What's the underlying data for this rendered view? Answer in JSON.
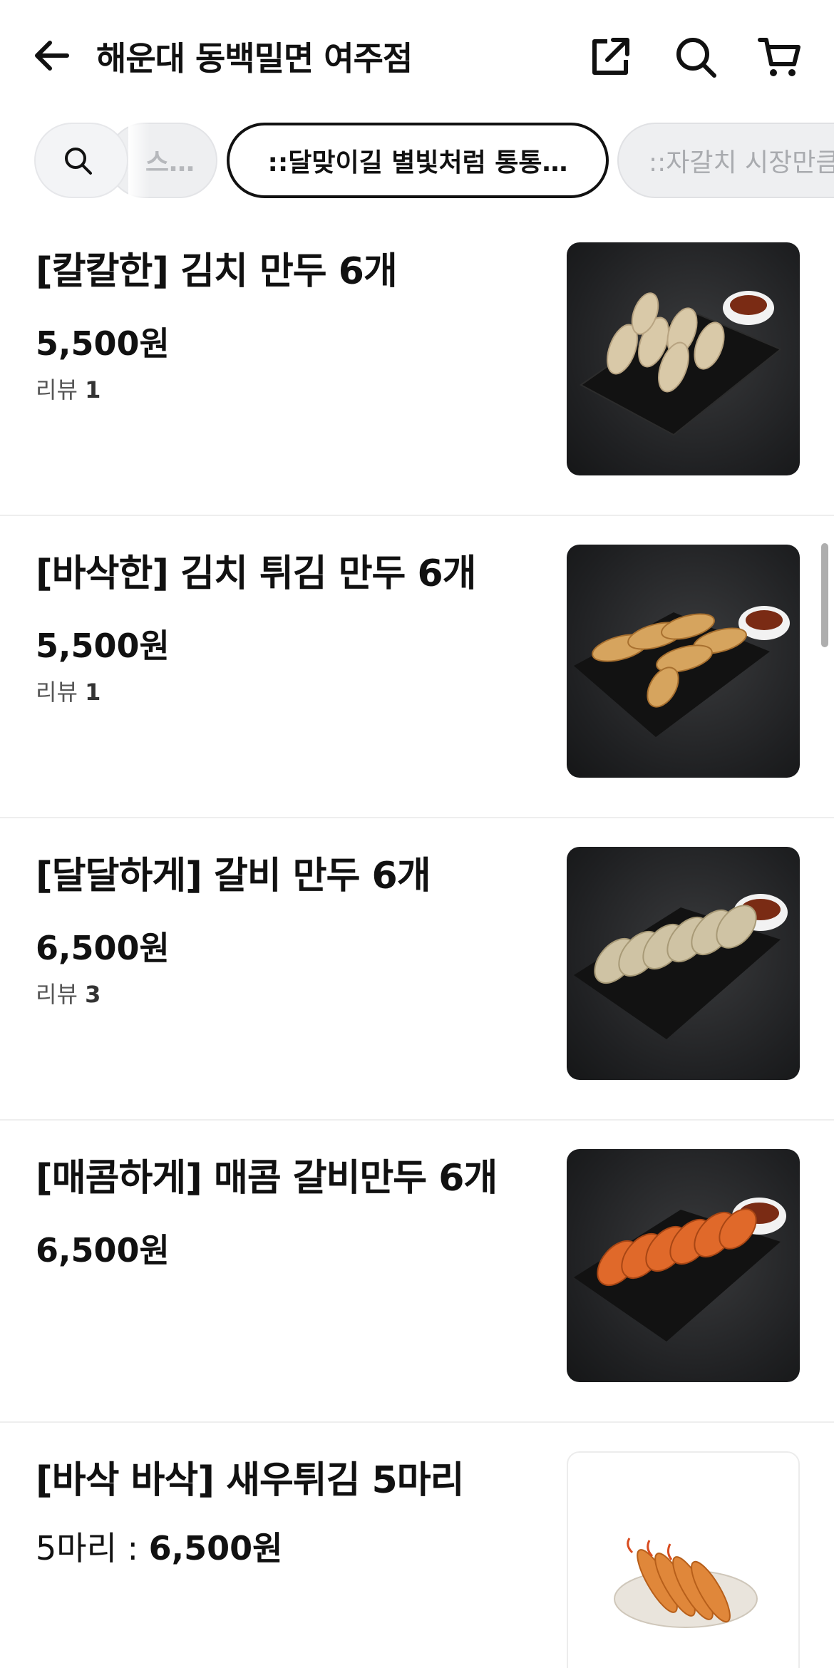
{
  "header": {
    "title": "해운대 동백밀면 여주점",
    "icons": {
      "back": "arrow-left-icon",
      "share": "share-icon",
      "search": "search-icon",
      "cart": "cart-icon"
    }
  },
  "chips": {
    "search_icon": "search-icon",
    "items": [
      {
        "label": "스…",
        "state": "partial"
      },
      {
        "label": "::달맞이길 별빛처럼 통통…",
        "state": "selected"
      },
      {
        "label": "::자갈치 시장만큼",
        "state": "partial"
      }
    ]
  },
  "menu": {
    "items": [
      {
        "name": "[칼칼한] 김치 만두 6개",
        "price": "5,500원",
        "review_label": "리뷰",
        "review_count": "1"
      },
      {
        "name": "[바삭한] 김치 튀김 만두 6개",
        "price": "5,500원",
        "review_label": "리뷰",
        "review_count": "1"
      },
      {
        "name": "[달달하게] 갈비 만두 6개",
        "price": "6,500원",
        "review_label": "리뷰",
        "review_count": "3"
      },
      {
        "name": "[매콤하게] 매콤 갈비만두 6개",
        "price": "6,500원"
      },
      {
        "name": "[바삭 바삭] 새우튀김 5마리",
        "price_prefix": "5마리 : ",
        "price": "6,500원"
      }
    ]
  },
  "colors": {
    "text": "#111111",
    "muted": "#555555",
    "chip_bg": "#eeeff1",
    "divider": "#eeeeee"
  }
}
